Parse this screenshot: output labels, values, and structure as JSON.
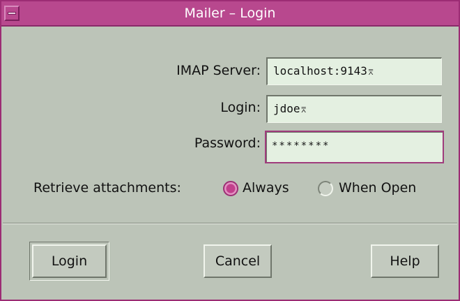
{
  "window": {
    "title": "Mailer – Login",
    "menu_icon": "window-menu-icon"
  },
  "form": {
    "imap_label": "IMAP Server:",
    "imap_value": "localhost:9143",
    "login_label": "Login:",
    "login_value": "jdoe",
    "password_label": "Password:",
    "password_value": "********",
    "attachments_label": "Retrieve attachments:",
    "options": [
      {
        "label": "Always",
        "selected": true
      },
      {
        "label": "When Open",
        "selected": false
      }
    ]
  },
  "buttons": {
    "login": "Login",
    "cancel": "Cancel",
    "help": "Help"
  },
  "colors": {
    "title_bar": "#b8488e",
    "background": "#bcc4b8",
    "field": "#e4f0e1",
    "accent": "#c23f8c"
  }
}
